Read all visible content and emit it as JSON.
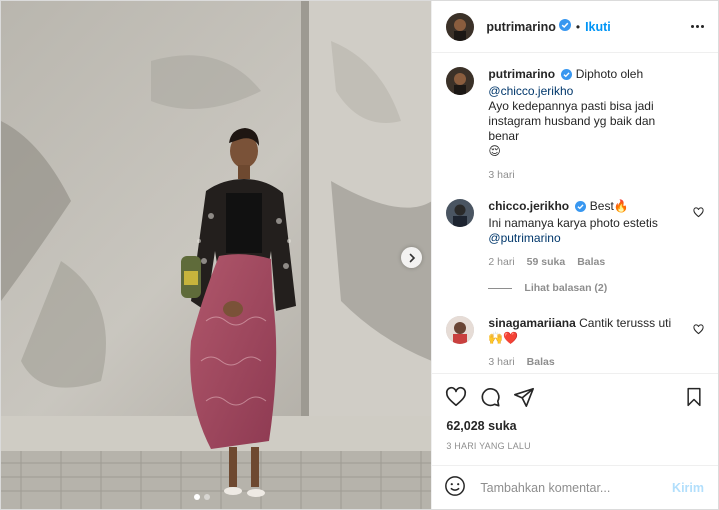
{
  "post": {
    "author": "putrimarino",
    "follow_label": "Ikuti",
    "separator": "•"
  },
  "caption": {
    "user": "putrimarino",
    "text_before": "Diphoto oleh",
    "mention": "@chicco.jerikho",
    "text_after": "Ayo kedepannya pasti bisa jadi instagram husband yg baik dan benar",
    "emoji": "😌",
    "time": "3 hari"
  },
  "comments": [
    {
      "user": "chicco.jerikho",
      "line1": "Best🔥",
      "line2": "Ini namanya karya photo estetis",
      "mention": "@putrimarino",
      "time": "2 hari",
      "likes": "59 suka",
      "reply_label": "Balas",
      "view_replies": "Lihat balasan (2)"
    },
    {
      "user": "sinagamariiana",
      "text": "Cantik terusss uti",
      "emoji": "🙌❤️",
      "time": "3 hari",
      "reply_label": "Balas"
    }
  ],
  "likes_count": "62,028 suka",
  "posted_time": "3 HARI YANG LALU",
  "comment_box": {
    "placeholder": "Tambahkan komentar...",
    "send_label": "Kirim"
  },
  "icons": {
    "verified": "verified-badge-icon",
    "more": "more-options-icon",
    "like": "heart-icon",
    "comment": "comment-icon",
    "share": "paper-plane-icon",
    "save": "bookmark-icon",
    "emoji": "smiley-icon",
    "next": "chevron-right-icon"
  },
  "colors": {
    "accent": "#0095f6",
    "verified": "#3897f0",
    "muted": "#8e8e8e",
    "send_disabled": "#b2dffc"
  },
  "carousel": {
    "slides": 2,
    "current": 1
  }
}
